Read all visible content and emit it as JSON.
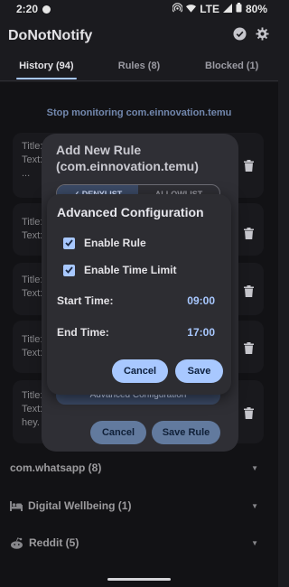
{
  "status": {
    "time": "2:20",
    "network": "LTE",
    "battery": "80%"
  },
  "app": {
    "title": "DoNotNotify"
  },
  "tabs": [
    {
      "label": "History (94)"
    },
    {
      "label": "Rules (8)"
    },
    {
      "label": "Blocked (1)"
    }
  ],
  "history": {
    "stop_link": "Stop monitoring com.einnovation.temu",
    "cards": [
      {
        "l1": "Title:",
        "l2": "Text:",
        "l3": "..."
      },
      {
        "l1": "Title:",
        "l2": "Text:"
      },
      {
        "l1": "Title:",
        "l2": "Text:",
        "trail": "..."
      },
      {
        "l1": "Title:",
        "l2": "Text:"
      },
      {
        "l1": "Title:",
        "l2": "Text:",
        "l3": "hey. F"
      }
    ],
    "sections": [
      {
        "label": "com.whatsapp (8)",
        "icon": "none"
      },
      {
        "label": "Digital Wellbeing (1)",
        "icon": "bed-icon"
      },
      {
        "label": "Reddit (5)",
        "icon": "reddit-icon"
      }
    ]
  },
  "rule_dialog": {
    "title": "Add New Rule (com.einnovation.temu)",
    "mode_denylist": "✓ DENYLIST",
    "mode_allowlist": "ALLOWLIST",
    "advanced_button": "Advanced Configuration",
    "cancel": "Cancel",
    "save": "Save Rule"
  },
  "advanced_dialog": {
    "title": "Advanced Configuration",
    "enable_rule": "Enable Rule",
    "enable_rule_checked": true,
    "enable_time_limit": "Enable Time Limit",
    "enable_time_limit_checked": true,
    "start_label": "Start Time:",
    "start_value": "09:00",
    "end_label": "End Time:",
    "end_value": "17:00",
    "cancel": "Cancel",
    "save": "Save"
  },
  "colors": {
    "accent": "#a8c8ff",
    "background": "#1b1b1f",
    "surface": "#2d2d32"
  }
}
